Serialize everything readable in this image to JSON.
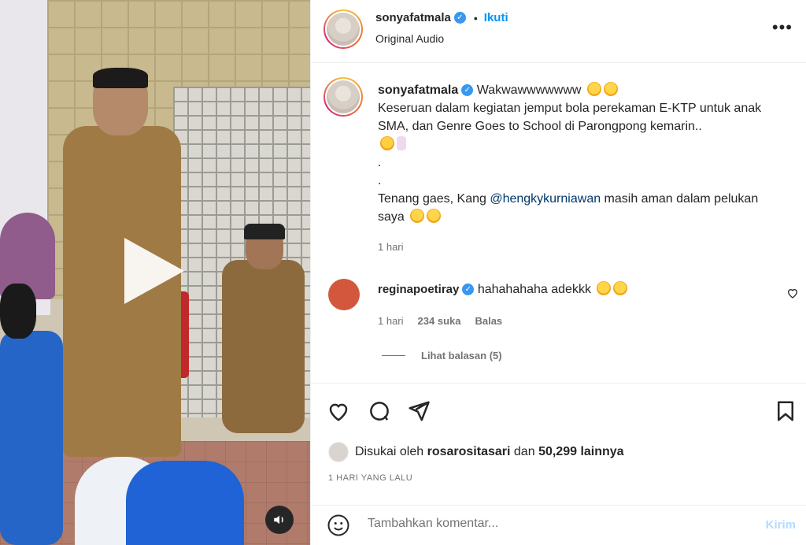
{
  "post": {
    "username": "sonyafatmala",
    "follow_label": "Ikuti",
    "audio": "Original Audio",
    "more_icon": "more-options-icon"
  },
  "caption": {
    "username": "sonyafatmala",
    "line1": "Wakwawwwwwww",
    "line2": "Keseruan dalam kegiatan jemput bola perekaman E-KTP untuk anak SMA, dan Genre Goes to School di Parongpong kemarin..",
    "dot1": ".",
    "dot2": ".",
    "line3_before": "Tenang gaes, Kang ",
    "mention": "@hengkykurniawan",
    "line3_after": " masih aman dalam pelukan saya",
    "time": "1 hari"
  },
  "comment": {
    "username": "reginapoetiray",
    "text": "hahahahaha adekkk",
    "time": "1 hari",
    "likes": "234 suka",
    "reply": "Balas",
    "view_replies": "Lihat balasan (5)"
  },
  "actions": {
    "liked_by_prefix": "Disukai oleh",
    "liked_by_user": "rosarositasari",
    "liked_by_mid": "dan",
    "liked_by_count": "50,299 lainnya",
    "date": "1 HARI YANG LALU"
  },
  "add_comment": {
    "placeholder": "Tambahkan komentar...",
    "post_label": "Kirim"
  },
  "colors": {
    "accent": "#0095f6",
    "verified": "#3897f0",
    "muted": "#737373"
  }
}
